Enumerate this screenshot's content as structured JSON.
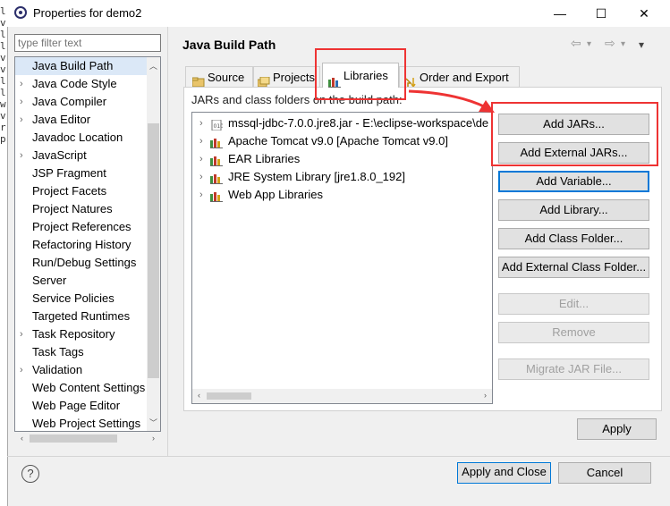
{
  "window": {
    "title": "Properties for demo2",
    "controls": {
      "minimize": "—",
      "maximize": "☐",
      "close": "✕"
    }
  },
  "background_fragments": [
    "l",
    "v",
    "l",
    "l",
    "v",
    "v",
    "l",
    "l",
    "w",
    "v",
    "r",
    "p"
  ],
  "filter": {
    "placeholder": "type filter text",
    "value": ""
  },
  "nav": {
    "items": [
      {
        "label": "Java Build Path",
        "expandable": false,
        "selected": true
      },
      {
        "label": "Java Code Style",
        "expandable": true
      },
      {
        "label": "Java Compiler",
        "expandable": true
      },
      {
        "label": "Java Editor",
        "expandable": true
      },
      {
        "label": "Javadoc Location",
        "expandable": false
      },
      {
        "label": "JavaScript",
        "expandable": true
      },
      {
        "label": "JSP Fragment",
        "expandable": false
      },
      {
        "label": "Project Facets",
        "expandable": false
      },
      {
        "label": "Project Natures",
        "expandable": false
      },
      {
        "label": "Project References",
        "expandable": false
      },
      {
        "label": "Refactoring History",
        "expandable": false
      },
      {
        "label": "Run/Debug Settings",
        "expandable": false
      },
      {
        "label": "Server",
        "expandable": false
      },
      {
        "label": "Service Policies",
        "expandable": false
      },
      {
        "label": "Targeted Runtimes",
        "expandable": false
      },
      {
        "label": "Task Repository",
        "expandable": true
      },
      {
        "label": "Task Tags",
        "expandable": false
      },
      {
        "label": "Validation",
        "expandable": true
      },
      {
        "label": "Web Content Settings",
        "expandable": false
      },
      {
        "label": "Web Page Editor",
        "expandable": false
      },
      {
        "label": "Web Project Settings",
        "expandable": false
      }
    ]
  },
  "page": {
    "title": "Java Build Path",
    "nav_controls": {
      "back": "⇦",
      "forward": "⇨",
      "menu": "▾"
    },
    "tabs": [
      {
        "label": "Source",
        "active": false,
        "icon": "source-folder-icon"
      },
      {
        "label": "Projects",
        "active": false,
        "icon": "projects-icon"
      },
      {
        "label": "Libraries",
        "active": true,
        "icon": "libraries-icon"
      },
      {
        "label": "Order and Export",
        "active": false,
        "icon": "order-export-icon"
      }
    ],
    "description": "JARs and class folders on the build path:",
    "libraries": [
      {
        "label": "mssql-jdbc-7.0.0.jre8.jar - E:\\eclipse-workspace\\de",
        "icon": "jar-icon"
      },
      {
        "label": "Apache Tomcat v9.0 [Apache Tomcat v9.0]",
        "icon": "library-icon"
      },
      {
        "label": "EAR Libraries",
        "icon": "library-icon"
      },
      {
        "label": "JRE System Library [jre1.8.0_192]",
        "icon": "library-icon"
      },
      {
        "label": "Web App Libraries",
        "icon": "library-icon"
      }
    ],
    "buttons": {
      "add_jars": "Add JARs...",
      "add_external_jars": "Add External JARs...",
      "add_variable": "Add Variable...",
      "add_library": "Add Library...",
      "add_class_folder": "Add Class Folder...",
      "add_external_class_folder": "Add External Class Folder...",
      "edit": "Edit...",
      "remove": "Remove",
      "migrate_jar": "Migrate JAR File..."
    },
    "apply": "Apply"
  },
  "footer": {
    "help": "?",
    "apply_and_close": "Apply and Close",
    "cancel": "Cancel"
  },
  "colors": {
    "annotation": "#e33333",
    "focus": "#0078d7",
    "selection": "#dbe8f7"
  }
}
